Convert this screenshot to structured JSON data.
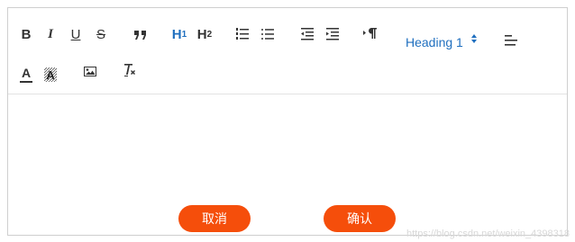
{
  "toolbar": {
    "bold_icon": "bold-icon",
    "italic_icon": "italic-icon",
    "underline_icon": "underline-icon",
    "strike_icon": "strikethrough-icon",
    "quote_icon": "blockquote-icon",
    "h1": {
      "main": "H",
      "sub": "1"
    },
    "h2": {
      "main": "H",
      "sub": "2"
    },
    "ordered_list_icon": "ordered-list-icon",
    "bullet_list_icon": "bullet-list-icon",
    "outdent_icon": "outdent-icon",
    "indent_icon": "indent-icon",
    "direction_icon": "text-direction-icon",
    "heading_select": {
      "value": "Heading 1"
    },
    "align_icon": "align-icon",
    "text_color_icon": "text-color-icon",
    "bg_color_icon": "background-color-icon",
    "image_icon": "image-icon",
    "clean_icon": "clear-format-icon"
  },
  "colors": {
    "accent_blue": "#1f6fbf",
    "button_orange": "#f54e0b",
    "border": "#cfcfcf"
  },
  "buttons": {
    "cancel_label": "取消",
    "confirm_label": "确认"
  },
  "watermark": "https://blog.csdn.net/weixin_4398318"
}
